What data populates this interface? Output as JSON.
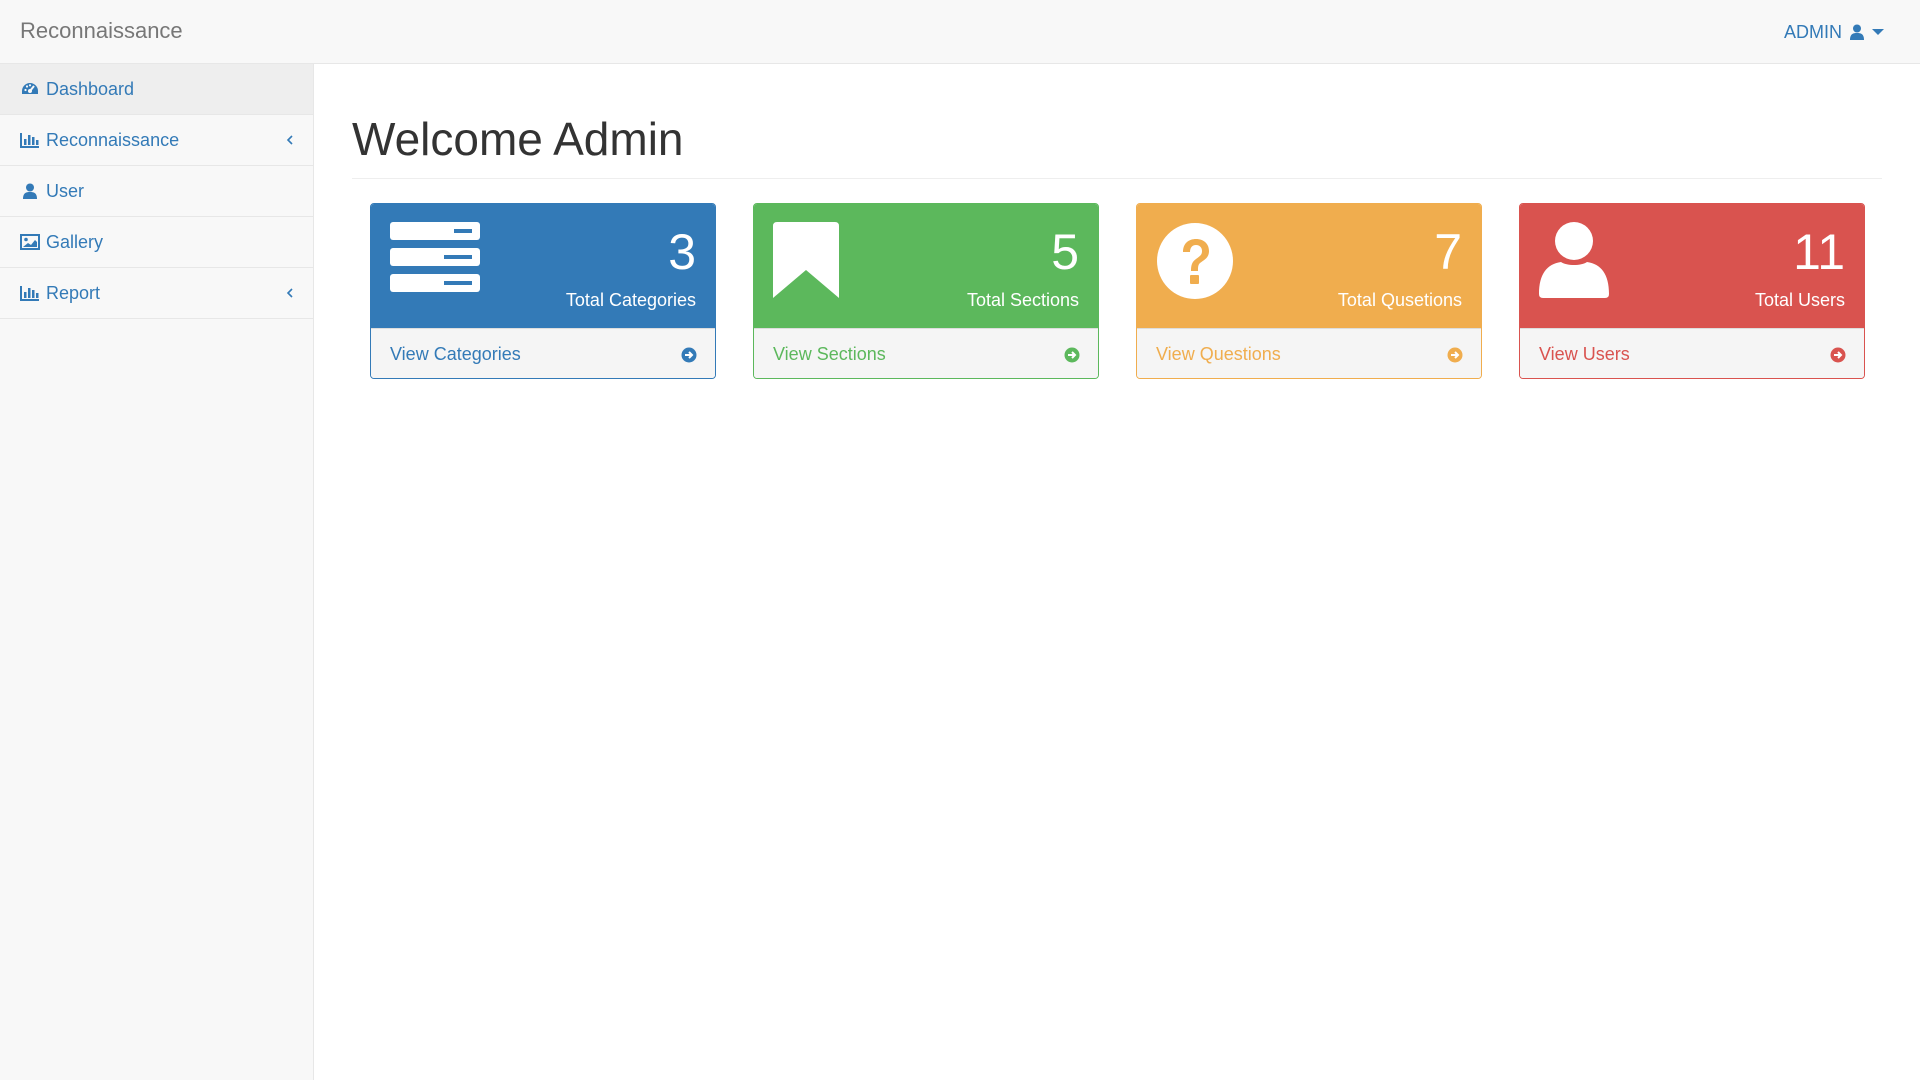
{
  "navbar": {
    "brand": "Reconnaissance",
    "user_label": "ADMIN",
    "user_icon": "user-icon",
    "caret_icon": "caret-down-icon"
  },
  "sidebar": {
    "items": [
      {
        "label": "Dashboard",
        "icon": "dashboard-icon",
        "active": true
      },
      {
        "label": "Reconnaissance",
        "icon": "bar-chart-icon",
        "has_submenu": true
      },
      {
        "label": "User",
        "icon": "user-icon"
      },
      {
        "label": "Gallery",
        "icon": "picture-icon"
      },
      {
        "label": "Report",
        "icon": "bar-chart-icon",
        "has_submenu": true
      }
    ]
  },
  "main": {
    "title": "Welcome Admin",
    "cards": [
      {
        "count": "3",
        "label": "Total Categories",
        "link": "View Categories",
        "icon": "list-icon",
        "color": "#337ab7"
      },
      {
        "count": "5",
        "label": "Total Sections",
        "link": "View Sections",
        "icon": "bookmark-icon",
        "color": "#5cb85c"
      },
      {
        "count": "7",
        "label": "Total Qusetions",
        "link": "View Questions",
        "icon": "question-circle-icon",
        "color": "#f0ad4e"
      },
      {
        "count": "11",
        "label": "Total Users",
        "link": "View Users",
        "icon": "user-icon",
        "color": "#d9534f"
      }
    ]
  }
}
